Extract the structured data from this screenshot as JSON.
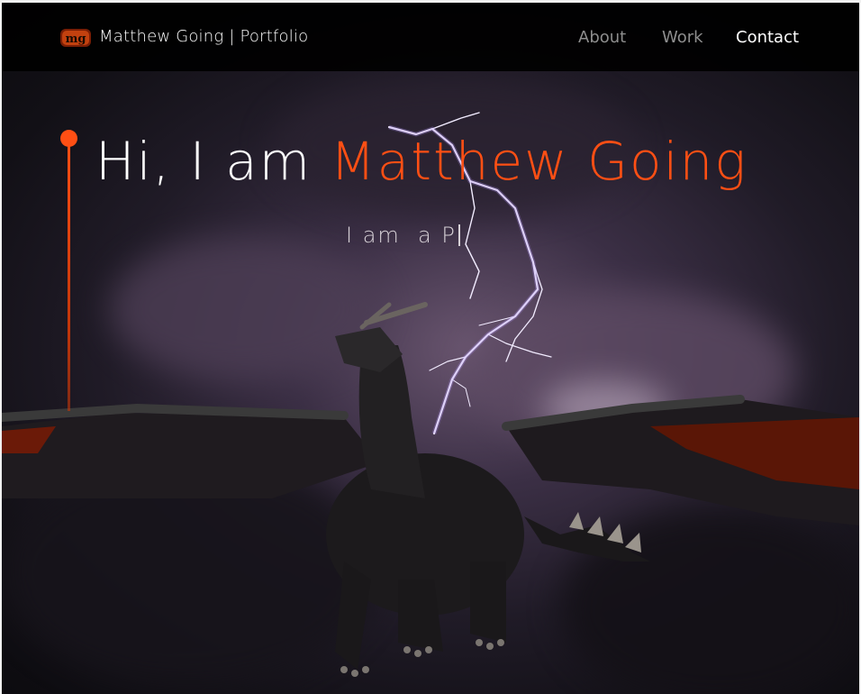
{
  "navbar": {
    "brand": "Matthew Going | Portfolio",
    "logo_text": "mg",
    "links": [
      {
        "label": "About",
        "active": false
      },
      {
        "label": "Work",
        "active": false
      },
      {
        "label": "Contact",
        "active": true
      }
    ]
  },
  "hero": {
    "greeting": "Hi, I am ",
    "name": "Matthew Going",
    "typed_text": "I am  a P"
  },
  "colors": {
    "accent": "#ff4f14",
    "nav_inactive": "#8e8e8e",
    "nav_active": "#ffffff",
    "navbar_bg": "#000000"
  },
  "icons": {
    "logo": "mg-logo-icon",
    "timeline": "timeline-dot-icon"
  }
}
